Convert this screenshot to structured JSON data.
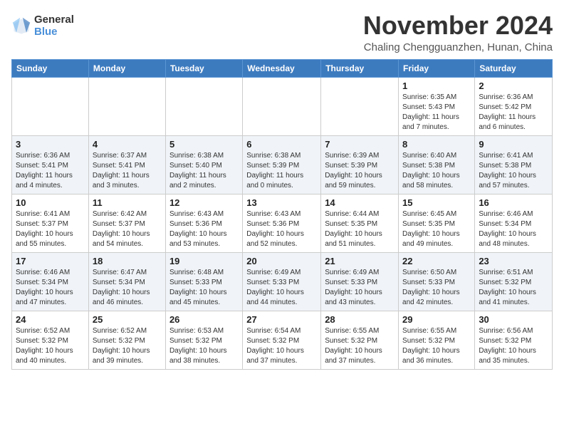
{
  "logo": {
    "general": "General",
    "blue": "Blue"
  },
  "header": {
    "month": "November 2024",
    "location": "Chaling Chengguanzhen, Hunan, China"
  },
  "weekdays": [
    "Sunday",
    "Monday",
    "Tuesday",
    "Wednesday",
    "Thursday",
    "Friday",
    "Saturday"
  ],
  "weeks": [
    [
      {
        "day": "",
        "info": ""
      },
      {
        "day": "",
        "info": ""
      },
      {
        "day": "",
        "info": ""
      },
      {
        "day": "",
        "info": ""
      },
      {
        "day": "",
        "info": ""
      },
      {
        "day": "1",
        "info": "Sunrise: 6:35 AM\nSunset: 5:43 PM\nDaylight: 11 hours and 7 minutes."
      },
      {
        "day": "2",
        "info": "Sunrise: 6:36 AM\nSunset: 5:42 PM\nDaylight: 11 hours and 6 minutes."
      }
    ],
    [
      {
        "day": "3",
        "info": "Sunrise: 6:36 AM\nSunset: 5:41 PM\nDaylight: 11 hours and 4 minutes."
      },
      {
        "day": "4",
        "info": "Sunrise: 6:37 AM\nSunset: 5:41 PM\nDaylight: 11 hours and 3 minutes."
      },
      {
        "day": "5",
        "info": "Sunrise: 6:38 AM\nSunset: 5:40 PM\nDaylight: 11 hours and 2 minutes."
      },
      {
        "day": "6",
        "info": "Sunrise: 6:38 AM\nSunset: 5:39 PM\nDaylight: 11 hours and 0 minutes."
      },
      {
        "day": "7",
        "info": "Sunrise: 6:39 AM\nSunset: 5:39 PM\nDaylight: 10 hours and 59 minutes."
      },
      {
        "day": "8",
        "info": "Sunrise: 6:40 AM\nSunset: 5:38 PM\nDaylight: 10 hours and 58 minutes."
      },
      {
        "day": "9",
        "info": "Sunrise: 6:41 AM\nSunset: 5:38 PM\nDaylight: 10 hours and 57 minutes."
      }
    ],
    [
      {
        "day": "10",
        "info": "Sunrise: 6:41 AM\nSunset: 5:37 PM\nDaylight: 10 hours and 55 minutes."
      },
      {
        "day": "11",
        "info": "Sunrise: 6:42 AM\nSunset: 5:37 PM\nDaylight: 10 hours and 54 minutes."
      },
      {
        "day": "12",
        "info": "Sunrise: 6:43 AM\nSunset: 5:36 PM\nDaylight: 10 hours and 53 minutes."
      },
      {
        "day": "13",
        "info": "Sunrise: 6:43 AM\nSunset: 5:36 PM\nDaylight: 10 hours and 52 minutes."
      },
      {
        "day": "14",
        "info": "Sunrise: 6:44 AM\nSunset: 5:35 PM\nDaylight: 10 hours and 51 minutes."
      },
      {
        "day": "15",
        "info": "Sunrise: 6:45 AM\nSunset: 5:35 PM\nDaylight: 10 hours and 49 minutes."
      },
      {
        "day": "16",
        "info": "Sunrise: 6:46 AM\nSunset: 5:34 PM\nDaylight: 10 hours and 48 minutes."
      }
    ],
    [
      {
        "day": "17",
        "info": "Sunrise: 6:46 AM\nSunset: 5:34 PM\nDaylight: 10 hours and 47 minutes."
      },
      {
        "day": "18",
        "info": "Sunrise: 6:47 AM\nSunset: 5:34 PM\nDaylight: 10 hours and 46 minutes."
      },
      {
        "day": "19",
        "info": "Sunrise: 6:48 AM\nSunset: 5:33 PM\nDaylight: 10 hours and 45 minutes."
      },
      {
        "day": "20",
        "info": "Sunrise: 6:49 AM\nSunset: 5:33 PM\nDaylight: 10 hours and 44 minutes."
      },
      {
        "day": "21",
        "info": "Sunrise: 6:49 AM\nSunset: 5:33 PM\nDaylight: 10 hours and 43 minutes."
      },
      {
        "day": "22",
        "info": "Sunrise: 6:50 AM\nSunset: 5:33 PM\nDaylight: 10 hours and 42 minutes."
      },
      {
        "day": "23",
        "info": "Sunrise: 6:51 AM\nSunset: 5:32 PM\nDaylight: 10 hours and 41 minutes."
      }
    ],
    [
      {
        "day": "24",
        "info": "Sunrise: 6:52 AM\nSunset: 5:32 PM\nDaylight: 10 hours and 40 minutes."
      },
      {
        "day": "25",
        "info": "Sunrise: 6:52 AM\nSunset: 5:32 PM\nDaylight: 10 hours and 39 minutes."
      },
      {
        "day": "26",
        "info": "Sunrise: 6:53 AM\nSunset: 5:32 PM\nDaylight: 10 hours and 38 minutes."
      },
      {
        "day": "27",
        "info": "Sunrise: 6:54 AM\nSunset: 5:32 PM\nDaylight: 10 hours and 37 minutes."
      },
      {
        "day": "28",
        "info": "Sunrise: 6:55 AM\nSunset: 5:32 PM\nDaylight: 10 hours and 37 minutes."
      },
      {
        "day": "29",
        "info": "Sunrise: 6:55 AM\nSunset: 5:32 PM\nDaylight: 10 hours and 36 minutes."
      },
      {
        "day": "30",
        "info": "Sunrise: 6:56 AM\nSunset: 5:32 PM\nDaylight: 10 hours and 35 minutes."
      }
    ]
  ]
}
